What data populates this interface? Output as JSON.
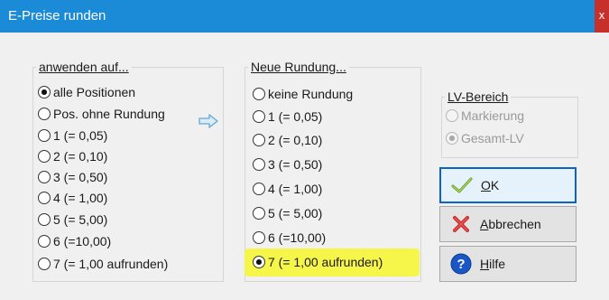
{
  "window": {
    "title": "E-Preise runden",
    "close_label": "x"
  },
  "group_apply": {
    "legend": "anwenden auf...",
    "options": [
      {
        "label": "alle Positionen",
        "selected": true
      },
      {
        "label": "Pos. ohne Rundung",
        "selected": false
      },
      {
        "label": "1  (= 0,05)",
        "selected": false
      },
      {
        "label": "2  (= 0,10)",
        "selected": false
      },
      {
        "label": "3  (= 0,50)",
        "selected": false
      },
      {
        "label": "4  (= 1,00)",
        "selected": false
      },
      {
        "label": "5  (= 5,00)",
        "selected": false
      },
      {
        "label": "6  (=10,00)",
        "selected": false
      },
      {
        "label": "7  (= 1,00 aufrunden)",
        "selected": false
      }
    ]
  },
  "group_new": {
    "legend": "Neue Rundung...",
    "options": [
      {
        "label": "keine Rundung",
        "selected": false
      },
      {
        "label": "1  (= 0,05)",
        "selected": false
      },
      {
        "label": "2  (= 0,10)",
        "selected": false
      },
      {
        "label": "3  (= 0,50)",
        "selected": false
      },
      {
        "label": "4  (= 1,00)",
        "selected": false
      },
      {
        "label": "5  (= 5,00)",
        "selected": false
      },
      {
        "label": "6  (=10,00)",
        "selected": false
      },
      {
        "label": "7  (= 1,00 aufrunden)",
        "selected": true
      }
    ],
    "highlight_color": "#f5f54a"
  },
  "group_lv": {
    "legend": "LV-Bereich",
    "options": [
      {
        "label": "Markierung",
        "selected": false
      },
      {
        "label": "Gesamt-LV",
        "selected": true
      }
    ]
  },
  "buttons": {
    "ok": {
      "first": "O",
      "rest": "K",
      "icon": "checkmark-icon"
    },
    "cancel": {
      "first": "A",
      "rest": "bbrechen",
      "icon": "red-x-icon"
    },
    "help": {
      "first": "H",
      "rest": "ilfe",
      "icon": "help-icon"
    }
  },
  "colors": {
    "titlebar": "#1b8ad7",
    "close": "#c6302b",
    "default_button_border": "#0a64c8"
  }
}
